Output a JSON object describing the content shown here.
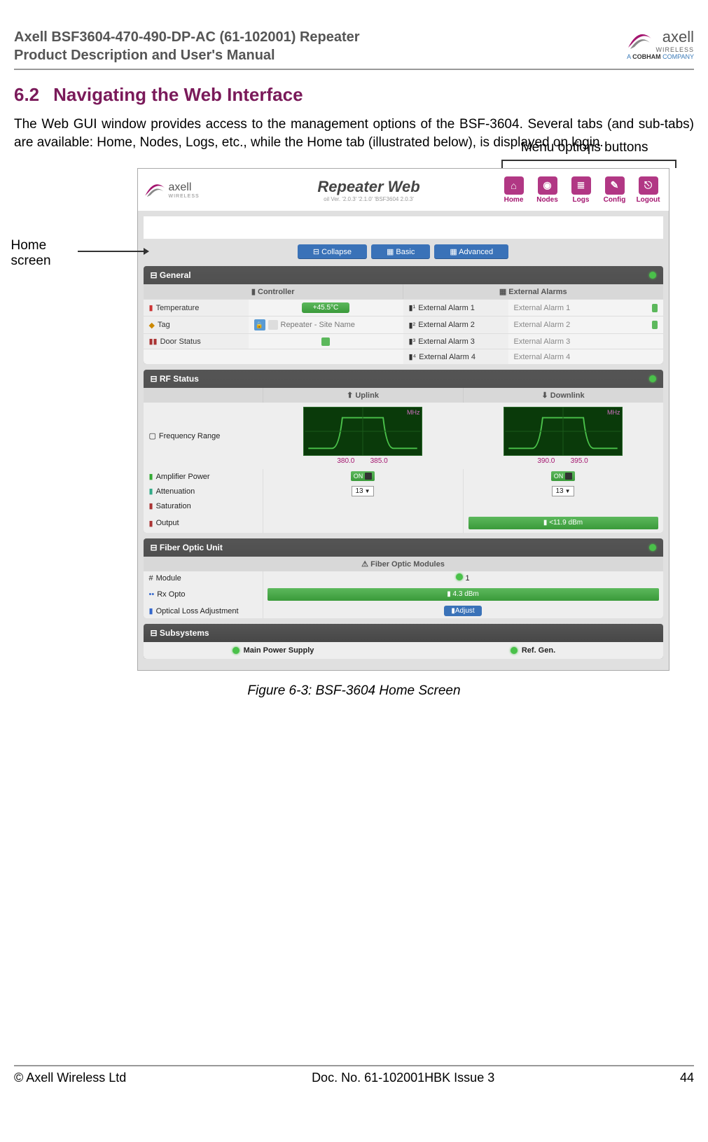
{
  "header": {
    "line1": "Axell BSF3604-470-490-DP-AC (61-102001) Repeater",
    "line2": "Product Description and User's Manual",
    "brand": "axell",
    "brand_sub": "WIRELESS",
    "brand_tag_prefix": "A ",
    "brand_tag_bold": "COBHAM",
    "brand_tag_suffix": " COMPANY"
  },
  "section": {
    "num": "6.2",
    "title": "Navigating the Web Interface"
  },
  "paragraph": "The Web GUI window provides access to the management options of the BSF-3604. Several tabs (and sub-tabs) are available: Home, Nodes, Logs, etc., while the Home tab (illustrated below), is displayed on login.",
  "annotations": {
    "menu": "Menu options buttons",
    "home_line1": "Home",
    "home_line2": "screen"
  },
  "screenshot": {
    "app_title": "Repeater Web",
    "version": "oil Ver. '2.0.3' '2.1.0' 'BSF3604 2.0.3'",
    "logo_text": "axell",
    "logo_sub": "WIRELESS",
    "nav": [
      "Home",
      "Nodes",
      "Logs",
      "Config",
      "Logout"
    ],
    "nav_icons": [
      "⌂",
      "◉",
      "≣",
      "✎",
      "⎋"
    ],
    "buttons": {
      "collapse": "⊟ Collapse",
      "basic": "▦ Basic",
      "advanced": "▦ Advanced"
    },
    "general": {
      "title": "General",
      "col_controller": "Controller",
      "col_alarms": "External Alarms",
      "temperature_label": "Temperature",
      "temperature_val": "+45.5°C",
      "tag_label": "Tag",
      "tag_val": "Repeater - Site Name",
      "door_label": "Door Status",
      "alarms": [
        {
          "label": "External Alarm 1",
          "val": "External Alarm 1"
        },
        {
          "label": "External Alarm 2",
          "val": "External Alarm 2"
        },
        {
          "label": "External Alarm 3",
          "val": "External Alarm 3"
        },
        {
          "label": "External Alarm 4",
          "val": "External Alarm 4"
        }
      ]
    },
    "rf": {
      "title": "RF Status",
      "uplink": "Uplink",
      "downlink": "Downlink",
      "freq_label": "Frequency Range",
      "mhz": "MHz",
      "uplink_range": [
        "380.0",
        "385.0"
      ],
      "downlink_range": [
        "390.0",
        "395.0"
      ],
      "amp_label": "Amplifier Power",
      "on": "ON",
      "att_label": "Attenuation",
      "att_val": "13",
      "sat_label": "Saturation",
      "out_label": "Output",
      "out_val": "<11.9 dBm"
    },
    "fiber": {
      "title": "Fiber Optic Unit",
      "sub": "Fiber Optic Modules",
      "module_label": "Module",
      "module_val": "1",
      "rx_label": "Rx Opto",
      "rx_val": "4.3 dBm",
      "loss_label": "Optical Loss Adjustment",
      "adjust": "Adjust"
    },
    "subsystems": {
      "title": "Subsystems",
      "main": "Main Power Supply",
      "ref": "Ref. Gen."
    }
  },
  "figure_caption": "Figure 6-3:  BSF-3604 Home Screen",
  "footer": {
    "left": "© Axell Wireless Ltd",
    "center": "Doc. No. 61-102001HBK Issue 3",
    "right": "44"
  }
}
